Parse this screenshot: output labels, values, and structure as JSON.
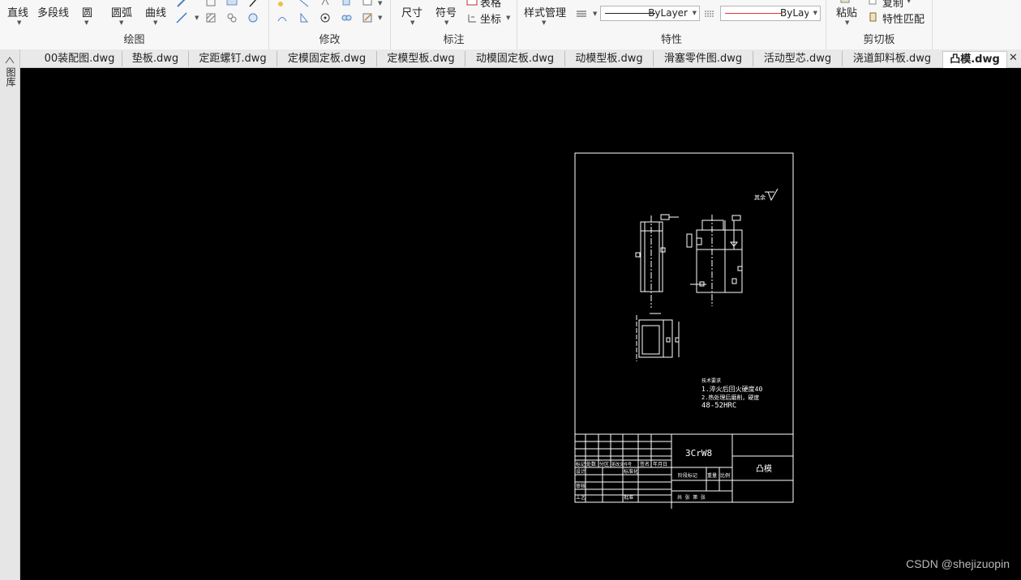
{
  "ribbon": {
    "draw": {
      "title": "绘图",
      "line": "直线",
      "polyline": "多段线",
      "circle": "圆",
      "arc": "圆弧",
      "curve": "曲线"
    },
    "modify": {
      "title": "修改"
    },
    "annotate": {
      "title": "标注",
      "dimension": "尺寸",
      "symbol": "符号",
      "table": "表格",
      "coordinate": "坐标"
    },
    "properties": {
      "title": "特性",
      "style_manager": "样式管理",
      "linetype_value": "ByLayer",
      "color_value": "ByLayer"
    },
    "clipboard": {
      "title": "剪切板",
      "paste": "粘贴",
      "copy": "复制",
      "match": "特性匹配"
    }
  },
  "tabs": [
    {
      "label": "00装配图.dwg"
    },
    {
      "label": "垫板.dwg"
    },
    {
      "label": "定距螺钉.dwg"
    },
    {
      "label": "定模固定板.dwg"
    },
    {
      "label": "定模型板.dwg"
    },
    {
      "label": "动模固定板.dwg"
    },
    {
      "label": "动模型板.dwg"
    },
    {
      "label": "滑塞零件图.dwg"
    },
    {
      "label": "活动型芯.dwg"
    },
    {
      "label": "浇道卸料板.dwg"
    },
    {
      "label": "凸模.dwg"
    }
  ],
  "active_tab": "凸模.dwg",
  "side_palette": {
    "label": "图库"
  },
  "drawing": {
    "roughness_mark": "其余",
    "notes_title": "技术要求",
    "note1": "1.淬火后回火硬度40",
    "note2": "2.热处理后磨削，硬度",
    "note3": "48-52HRC",
    "material": "3CrW8",
    "part_name": "凸模",
    "title_block": {
      "row_labels": [
        "标记",
        "处数",
        "分区",
        "更改文件号",
        "签名",
        "年月日"
      ],
      "design": "设计",
      "standardization": "标准化",
      "review": "审核",
      "process": "工艺",
      "approve": "批准",
      "stage": "阶段标记",
      "weight": "重量",
      "scale": "比例",
      "sheet": "共  张 第  张"
    }
  },
  "watermark": "CSDN @shejizuopin",
  "colors": {
    "canvas": "#000000",
    "line_color": "#e53935",
    "cad_line": "#ffffff"
  }
}
